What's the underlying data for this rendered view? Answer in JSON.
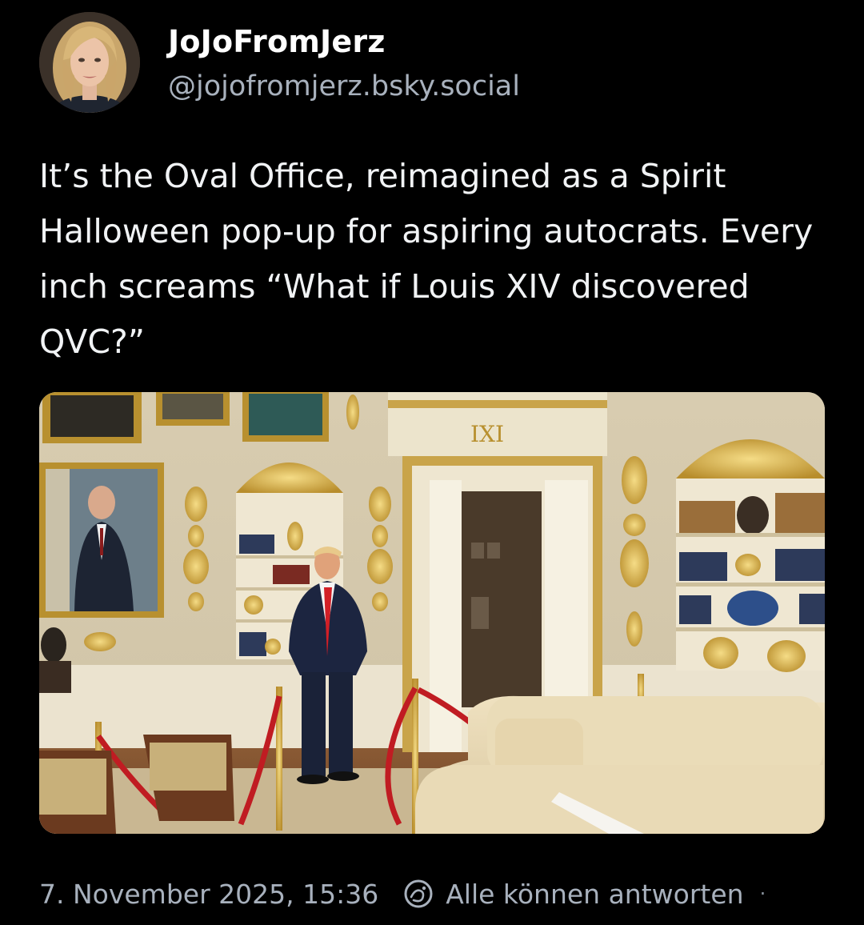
{
  "author": {
    "display_name": "JoJoFromJerz",
    "handle": "@jojofromjerz.bsky.social"
  },
  "post": {
    "text": "It’s the Oval Office, reimagined as a Spirit Halloween pop-up for aspiring autocrats. Every inch screams “What if Louis XIV discovered QVC?”",
    "image_label": "IXI"
  },
  "footer": {
    "timestamp": "7. November 2025, 15:36",
    "reply_setting": "Alle können antworten",
    "more_glyph": "·"
  },
  "icons": {
    "reply_setting_icon": "globe-icon",
    "avatar": "avatar"
  },
  "colors": {
    "background": "#000000",
    "primary_text": "#ffffff",
    "secondary_text": "#a8b1bd"
  }
}
